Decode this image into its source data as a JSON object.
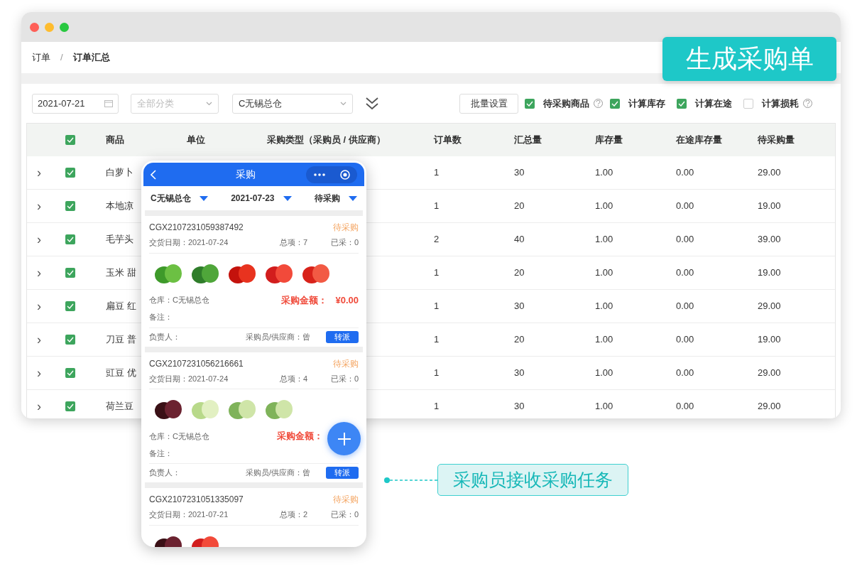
{
  "badge": "生成采购单",
  "breadcrumb": [
    "订单",
    "/",
    "订单汇总"
  ],
  "filters": {
    "date": "2021-07-21",
    "category_placeholder": "全部分类",
    "warehouse": "C无锡总仓"
  },
  "batch_button": "批量设置",
  "options": [
    {
      "label": "待采购商品",
      "checked": true,
      "help": true
    },
    {
      "label": "计算库存",
      "checked": true,
      "help": false
    },
    {
      "label": "计算在途",
      "checked": true,
      "help": false
    },
    {
      "label": "计算损耗",
      "checked": false,
      "help": true
    }
  ],
  "table": {
    "header_checked": true,
    "columns": [
      "商品",
      "单位",
      "采购类型（采购员 / 供应商）",
      "订单数",
      "汇总量",
      "库存量",
      "在途库存量",
      "待采购量"
    ],
    "rows": [
      {
        "expander": "›",
        "checked": true,
        "product": "白萝卜",
        "orders": "1",
        "total": "30",
        "stock": "1.00",
        "transit": "0.00",
        "pending": "29.00"
      },
      {
        "expander": "›",
        "checked": true,
        "product": "本地凉",
        "orders": "1",
        "total": "20",
        "stock": "1.00",
        "transit": "0.00",
        "pending": "19.00"
      },
      {
        "expander": "›",
        "checked": true,
        "product": "毛芋头",
        "orders": "2",
        "total": "40",
        "stock": "1.00",
        "transit": "0.00",
        "pending": "39.00"
      },
      {
        "expander": "›",
        "checked": true,
        "product": "玉米 甜",
        "orders": "1",
        "total": "20",
        "stock": "1.00",
        "transit": "0.00",
        "pending": "19.00"
      },
      {
        "expander": "›",
        "checked": true,
        "product": "扁豆 红",
        "orders": "1",
        "total": "30",
        "stock": "1.00",
        "transit": "0.00",
        "pending": "29.00"
      },
      {
        "expander": "›",
        "checked": true,
        "product": "刀豆 普",
        "orders": "1",
        "total": "20",
        "stock": "1.00",
        "transit": "0.00",
        "pending": "19.00"
      },
      {
        "expander": "›",
        "checked": true,
        "product": "豇豆 优",
        "orders": "1",
        "total": "30",
        "stock": "1.00",
        "transit": "0.00",
        "pending": "29.00"
      },
      {
        "expander": "›",
        "checked": true,
        "product": "荷兰豆",
        "orders": "1",
        "total": "30",
        "stock": "1.00",
        "transit": "0.00",
        "pending": "29.00"
      }
    ]
  },
  "phone": {
    "title": "采购",
    "filters": [
      "C无锡总仓",
      "2021-07-23",
      "待采购"
    ],
    "cards": [
      {
        "id": "CGX2107231059387492",
        "status": "待采购",
        "date": "交货日期：2021-07-24",
        "items": "总项：7",
        "done": "已采：0",
        "photos": [
          {
            "kind": "green-pepper"
          },
          {
            "kind": "green-bean"
          },
          {
            "kind": "red-chili"
          },
          {
            "kind": "cherry-tomato"
          },
          {
            "kind": "tomato"
          }
        ],
        "warehouse": "仓库：C无锡总仓",
        "amount_label": "采购金额：",
        "amount_value": "¥0.00",
        "note": "备注：",
        "owner": "负责人：",
        "buyer": "采购员/供应商：曾",
        "button": "转派"
      },
      {
        "id": "CGX2107231056216661",
        "status": "待采购",
        "date": "交货日期：2021-07-24",
        "items": "总项：4",
        "done": "已采：0",
        "photos": [
          {
            "kind": "plum"
          },
          {
            "kind": "napa-cabbage"
          },
          {
            "kind": "cabbage"
          },
          {
            "kind": "cabbage"
          }
        ],
        "warehouse": "仓库：C无锡总仓",
        "amount_label": "采购金额：",
        "note": "备注：",
        "owner": "负责人：",
        "buyer": "采购员/供应商：曾",
        "button": "转派"
      },
      {
        "id": "CGX2107231051335097",
        "status": "待采购",
        "date": "交货日期：2021-07-21",
        "items": "总项：2",
        "done": "已采：0",
        "photos": [
          {
            "kind": "plum"
          },
          {
            "kind": "cherry-tomato"
          }
        ]
      }
    ]
  },
  "callout": "采购员接收采购任务"
}
